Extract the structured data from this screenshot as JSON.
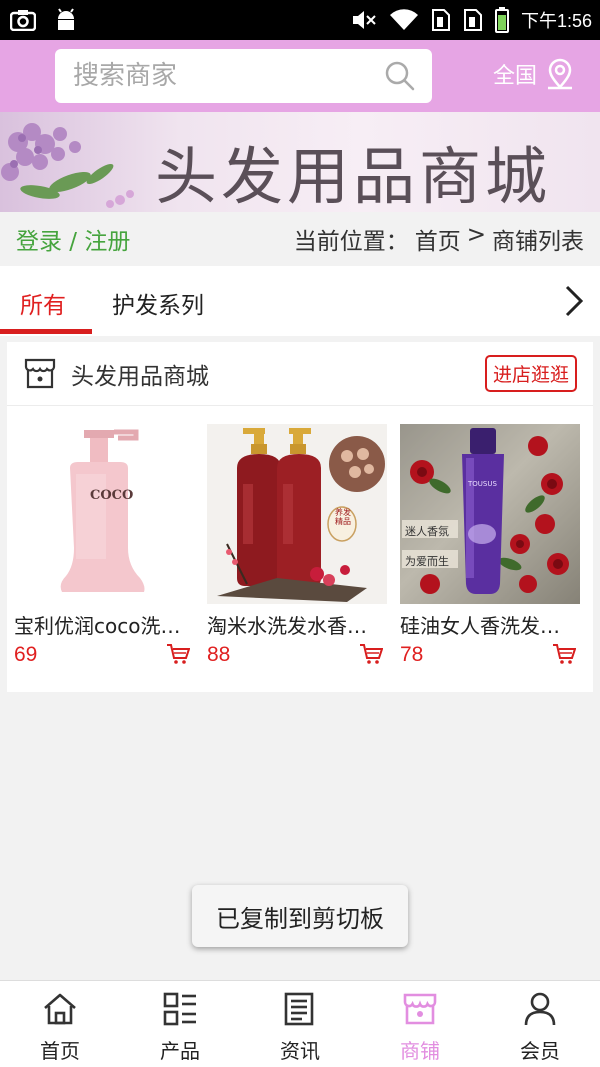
{
  "status_bar": {
    "time": "下午1:56",
    "icons": [
      "camera-icon",
      "android-icon",
      "mute-icon",
      "wifi-icon",
      "sim1-icon",
      "sim2-icon",
      "battery-icon"
    ]
  },
  "header": {
    "search_placeholder": "搜索商家",
    "region_label": "全国"
  },
  "banner": {
    "title": "头发用品商城"
  },
  "breadcrumb_row": {
    "login": "登录",
    "separator": " / ",
    "register": "注册",
    "location_prefix": "当前位置：",
    "home": "首页",
    "arrow": ">",
    "current": "商铺列表"
  },
  "tabs": [
    {
      "label": "所有",
      "active": true
    },
    {
      "label": "护发系列",
      "active": false
    }
  ],
  "shop": {
    "name": "头发用品商城",
    "visit_label": "进店逛逛",
    "products": [
      {
        "name": "宝利优润coco洗…",
        "price": "69",
        "image_text": "COCO"
      },
      {
        "name": "淘米水洗发水香…",
        "price": "88",
        "image_text": "养发精品"
      },
      {
        "name": "硅油女人香洗发…",
        "price": "78",
        "image_text_1": "迷人香氛",
        "image_text_2": "为爱而生",
        "image_text_3": "TOUSUS"
      }
    ]
  },
  "toast": "已复制到剪切板",
  "bottom_nav": [
    {
      "label": "首页",
      "icon": "home-icon",
      "active": false
    },
    {
      "label": "产品",
      "icon": "grid-list-icon",
      "active": false
    },
    {
      "label": "资讯",
      "icon": "news-icon",
      "active": false
    },
    {
      "label": "商铺",
      "icon": "shop-icon",
      "active": true
    },
    {
      "label": "会员",
      "icon": "user-icon",
      "active": false
    }
  ],
  "colors": {
    "header_bg": "#e6a5e4",
    "accent_red": "#d81e1e",
    "login_green": "#46a43e",
    "active_nav": "#e28ee0"
  }
}
